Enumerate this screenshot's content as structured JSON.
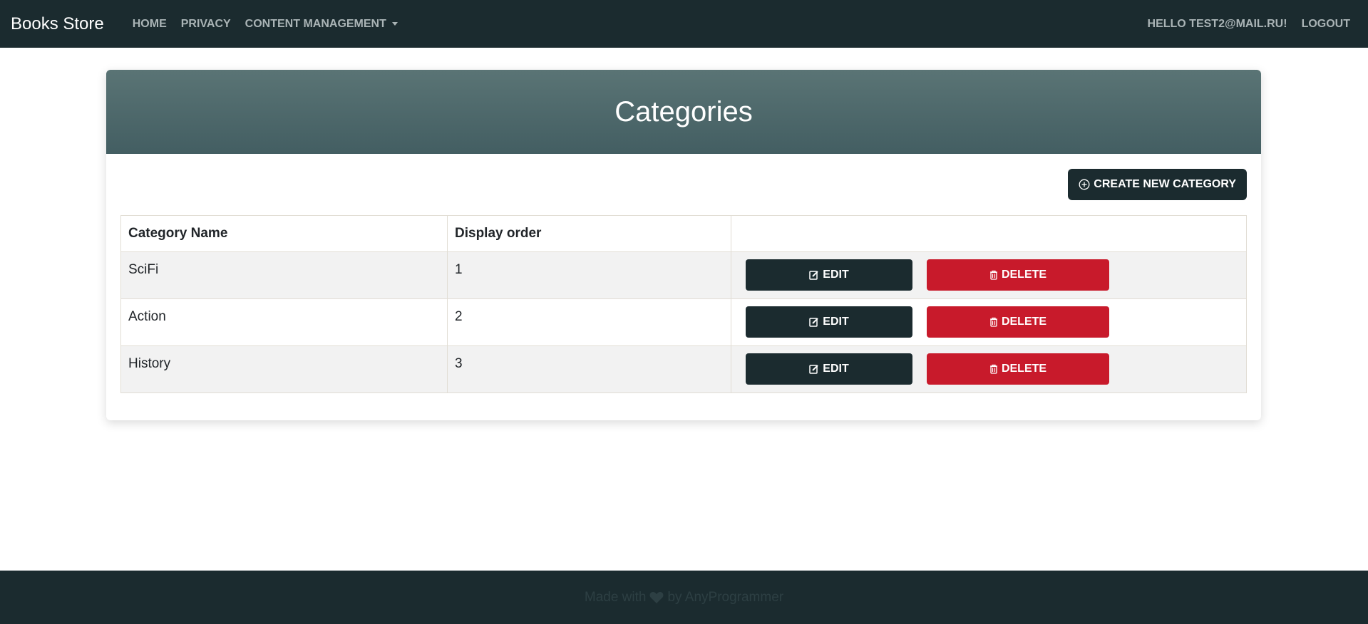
{
  "navbar": {
    "brand": "Books Store",
    "links": [
      "HOME",
      "PRIVACY",
      "CONTENT MANAGEMENT"
    ],
    "user_greeting": "HELLO TEST2@MAIL.RU!",
    "logout": "LOGOUT"
  },
  "page": {
    "title": "Categories",
    "create_button": "CREATE NEW CATEGORY"
  },
  "table": {
    "headers": [
      "Category Name",
      "Display order",
      ""
    ],
    "rows": [
      {
        "name": "SciFi",
        "order": "1"
      },
      {
        "name": "Action",
        "order": "2"
      },
      {
        "name": "History",
        "order": "3"
      }
    ],
    "edit_label": "EDIT",
    "delete_label": "DELETE"
  },
  "footer": {
    "text_before": "Made with",
    "text_after": "by AnyProgrammer"
  },
  "colors": {
    "navbar_bg": "#1b2b2f",
    "header_gradient_top": "#5a7475",
    "header_gradient_bottom": "#435e62",
    "delete_red": "#c81a2b"
  },
  "icons": {
    "create": "plus-circle-icon",
    "edit": "edit-icon",
    "delete": "trash-icon",
    "footer": "heart-icon"
  }
}
